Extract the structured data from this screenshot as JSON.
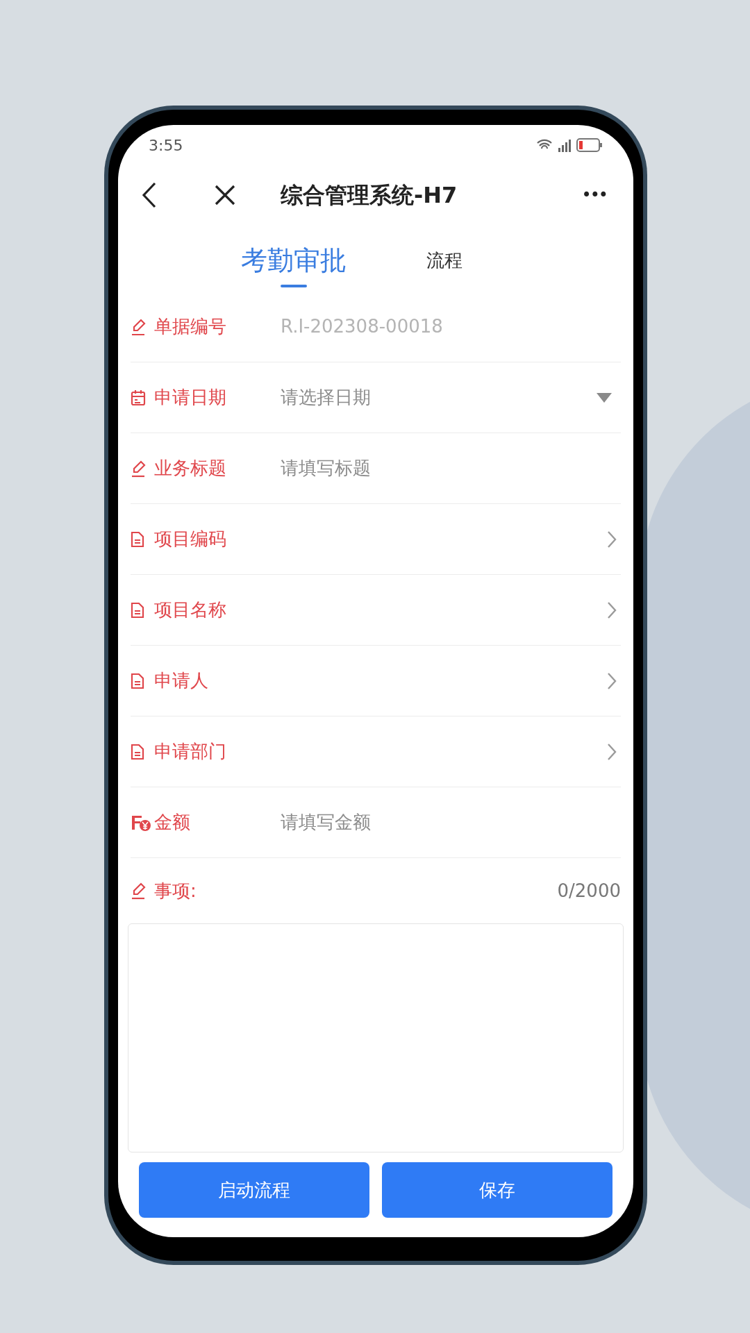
{
  "status_bar": {
    "time": "3:55"
  },
  "header": {
    "title": "综合管理系统-H7",
    "more": "•••"
  },
  "tabs": [
    {
      "label": "考勤审批",
      "selected": true
    },
    {
      "label": "流程",
      "selected": false
    }
  ],
  "fields": [
    {
      "kind": "readonly",
      "label": "单据编号",
      "value": "R.I-202308-00018"
    },
    {
      "kind": "date",
      "label": "申请日期",
      "placeholder": "请选择日期"
    },
    {
      "kind": "text",
      "label": "业务标题",
      "placeholder": "请填写标题"
    },
    {
      "kind": "picker",
      "label": "项目编码"
    },
    {
      "kind": "picker",
      "label": "项目名称"
    },
    {
      "kind": "picker",
      "label": "申请人"
    },
    {
      "kind": "picker",
      "label": "申请部门"
    },
    {
      "kind": "amount",
      "label": "金额",
      "placeholder": "请填写金额"
    }
  ],
  "notes": {
    "label": "事项:",
    "counter": "0/2000"
  },
  "buttons": [
    {
      "label": "启动流程"
    },
    {
      "label": "保存"
    }
  ]
}
